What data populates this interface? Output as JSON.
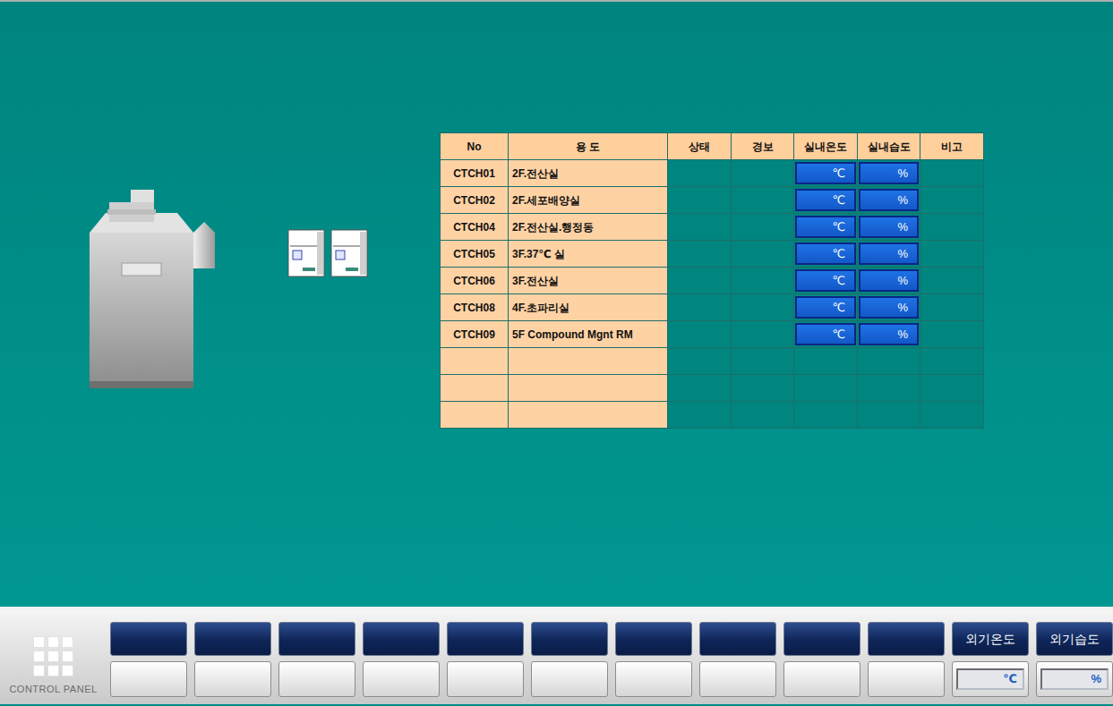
{
  "table": {
    "columns": [
      "No",
      "용 도",
      "상태",
      "경보",
      "실내온도",
      "실내습도",
      "비고"
    ],
    "rows": [
      {
        "no": "CTCH01",
        "use": "2F.전산실",
        "temp_unit": "℃",
        "humidity_unit": "%"
      },
      {
        "no": "CTCH02",
        "use": "2F.세포배양실",
        "temp_unit": "℃",
        "humidity_unit": "%"
      },
      {
        "no": "CTCH04",
        "use": "2F.전산실.행정동",
        "temp_unit": "℃",
        "humidity_unit": "%"
      },
      {
        "no": "CTCH05",
        "use": "3F.37℃ 실",
        "temp_unit": "℃",
        "humidity_unit": "%"
      },
      {
        "no": "CTCH06",
        "use": "3F.전산실",
        "temp_unit": "℃",
        "humidity_unit": "%"
      },
      {
        "no": "CTCH08",
        "use": "4F.초파리실",
        "temp_unit": "℃",
        "humidity_unit": "%"
      },
      {
        "no": "CTCH09",
        "use": "5F Compound Mgnt RM",
        "temp_unit": "℃",
        "humidity_unit": "%"
      },
      {
        "no": "",
        "use": ""
      },
      {
        "no": "",
        "use": ""
      },
      {
        "no": "",
        "use": ""
      }
    ]
  },
  "control_panel": {
    "label": "CONTROL PANEL"
  },
  "bottom_buttons": [
    {
      "top": "",
      "bottom": ""
    },
    {
      "top": "",
      "bottom": ""
    },
    {
      "top": "",
      "bottom": ""
    },
    {
      "top": "",
      "bottom": ""
    },
    {
      "top": "",
      "bottom": ""
    },
    {
      "top": "",
      "bottom": ""
    },
    {
      "top": "",
      "bottom": ""
    },
    {
      "top": "",
      "bottom": ""
    },
    {
      "top": "",
      "bottom": ""
    },
    {
      "top": "",
      "bottom": ""
    }
  ],
  "outdoor": [
    {
      "label": "외기온도",
      "unit": "℃"
    },
    {
      "label": "외기습도",
      "unit": "%"
    }
  ]
}
